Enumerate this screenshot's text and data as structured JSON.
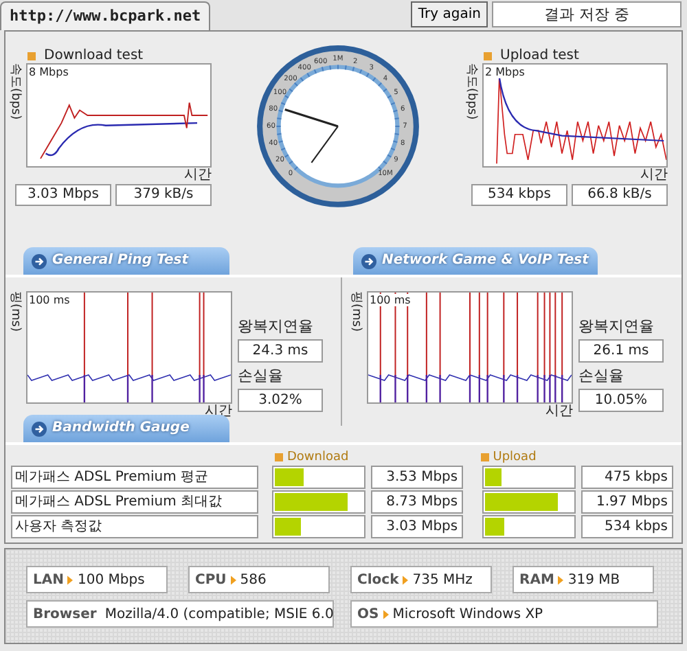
{
  "tab_title": "http://www.bcpark.net",
  "try_again_button": "Try again",
  "status_field": "결과 저장 중",
  "download_test": {
    "title": "Download test",
    "y_axis": "속도(bps)",
    "max_label": "8 Mbps",
    "x_axis": "시간",
    "speed": "3.03 Mbps",
    "rate": "379 kB/s"
  },
  "gauge": {
    "low_scale": [
      "100",
      "80",
      "60",
      "40",
      "20",
      "0"
    ],
    "high_scale": [
      "200",
      "400",
      "600",
      "1M",
      "2",
      "3",
      "4",
      "5",
      "6",
      "7",
      "8",
      "9",
      "10M"
    ]
  },
  "upload_test": {
    "title": "Upload test",
    "y_axis": "속도(bps)",
    "max_label": "2 Mbps",
    "x_axis": "시간",
    "speed": "534 kbps",
    "rate": "66.8 kB/s"
  },
  "section_tabs": [
    "General Ping Test",
    "Network Game & VoIP Test"
  ],
  "ping_tests": [
    {
      "y_axis": "핑(ms)",
      "max_label": "100 ms",
      "x_axis": "시간",
      "latency_label": "왕복지연율",
      "latency": "24.3 ms",
      "loss_label": "손실율",
      "loss": "3.02%"
    },
    {
      "y_axis": "핑(ms)",
      "max_label": "100 ms",
      "x_axis": "시간",
      "latency_label": "왕복지연율",
      "latency": "26.1 ms",
      "loss_label": "손실율",
      "loss": "10.05%"
    }
  ],
  "bandwidth_gauge": {
    "title": "Bandwidth Gauge",
    "columns": [
      "Download",
      "Upload"
    ],
    "rows": [
      {
        "label": "메가패스 ADSL Premium 평균",
        "download": {
          "level": 0.33,
          "value": "3.53 Mbps"
        },
        "upload": {
          "level": 0.19,
          "value": "475 kbps"
        }
      },
      {
        "label": "메가패스 ADSL Premium 최대값",
        "download": {
          "level": 0.82,
          "value": "8.73 Mbps"
        },
        "upload": {
          "level": 0.83,
          "value": "1.97 Mbps"
        }
      },
      {
        "label": "사용자 측정값",
        "download": {
          "level": 0.29,
          "value": "3.03 Mbps"
        },
        "upload": {
          "level": 0.21,
          "value": "534 kbps"
        }
      }
    ]
  },
  "system_info": [
    {
      "label": "LAN",
      "value": "100 Mbps"
    },
    {
      "label": "CPU",
      "value": "586"
    },
    {
      "label": "Clock",
      "value": "735 MHz"
    },
    {
      "label": "RAM",
      "value": "319 MB"
    },
    {
      "label": "Browser",
      "value": "Mozilla/4.0 (compatible; MSIE 6.0"
    },
    {
      "label": "OS",
      "value": "Microsoft Windows XP"
    }
  ]
}
